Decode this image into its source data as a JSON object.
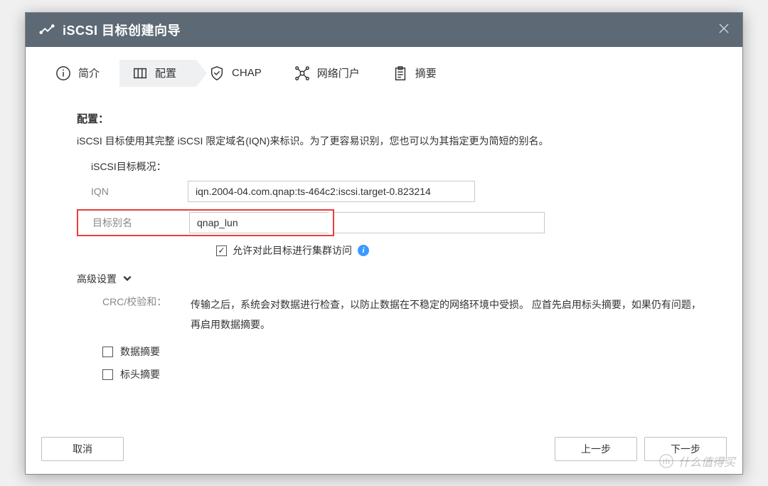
{
  "titlebar": {
    "title": "iSCSI 目标创建向导"
  },
  "stepper": {
    "intro": "简介",
    "config": "配置",
    "chap": "CHAP",
    "portal": "网络门户",
    "summary": "摘要"
  },
  "content": {
    "section_title": "配置：",
    "section_desc": "iSCSI 目标使用其完整 iSCSI 限定域名(IQN)来标识。为了更容易识别，您也可以为其指定更为简短的别名。",
    "target_overview_label": "iSCSI目标概况：",
    "iqn_label": "IQN",
    "iqn_value": "iqn.2004-04.com.qnap:ts-464c2:iscsi.target-0.823214",
    "alias_label": "目标别名",
    "alias_value": "qnap_lun",
    "cluster_checkbox_label": "允许对此目标进行集群访问",
    "advanced_label": "高级设置",
    "crc_label": "CRC/校验和：",
    "crc_desc": "传输之后，系统会对数据进行检查，以防止数据在不稳定的网络环境中受损。 应首先启用标头摘要，如果仍有问题，再启用数据摘要。",
    "data_digest": "数据摘要",
    "header_digest": "标头摘要"
  },
  "footer": {
    "cancel": "取消",
    "prev": "上一步",
    "next": "下一步"
  },
  "watermark": "什么值得买"
}
